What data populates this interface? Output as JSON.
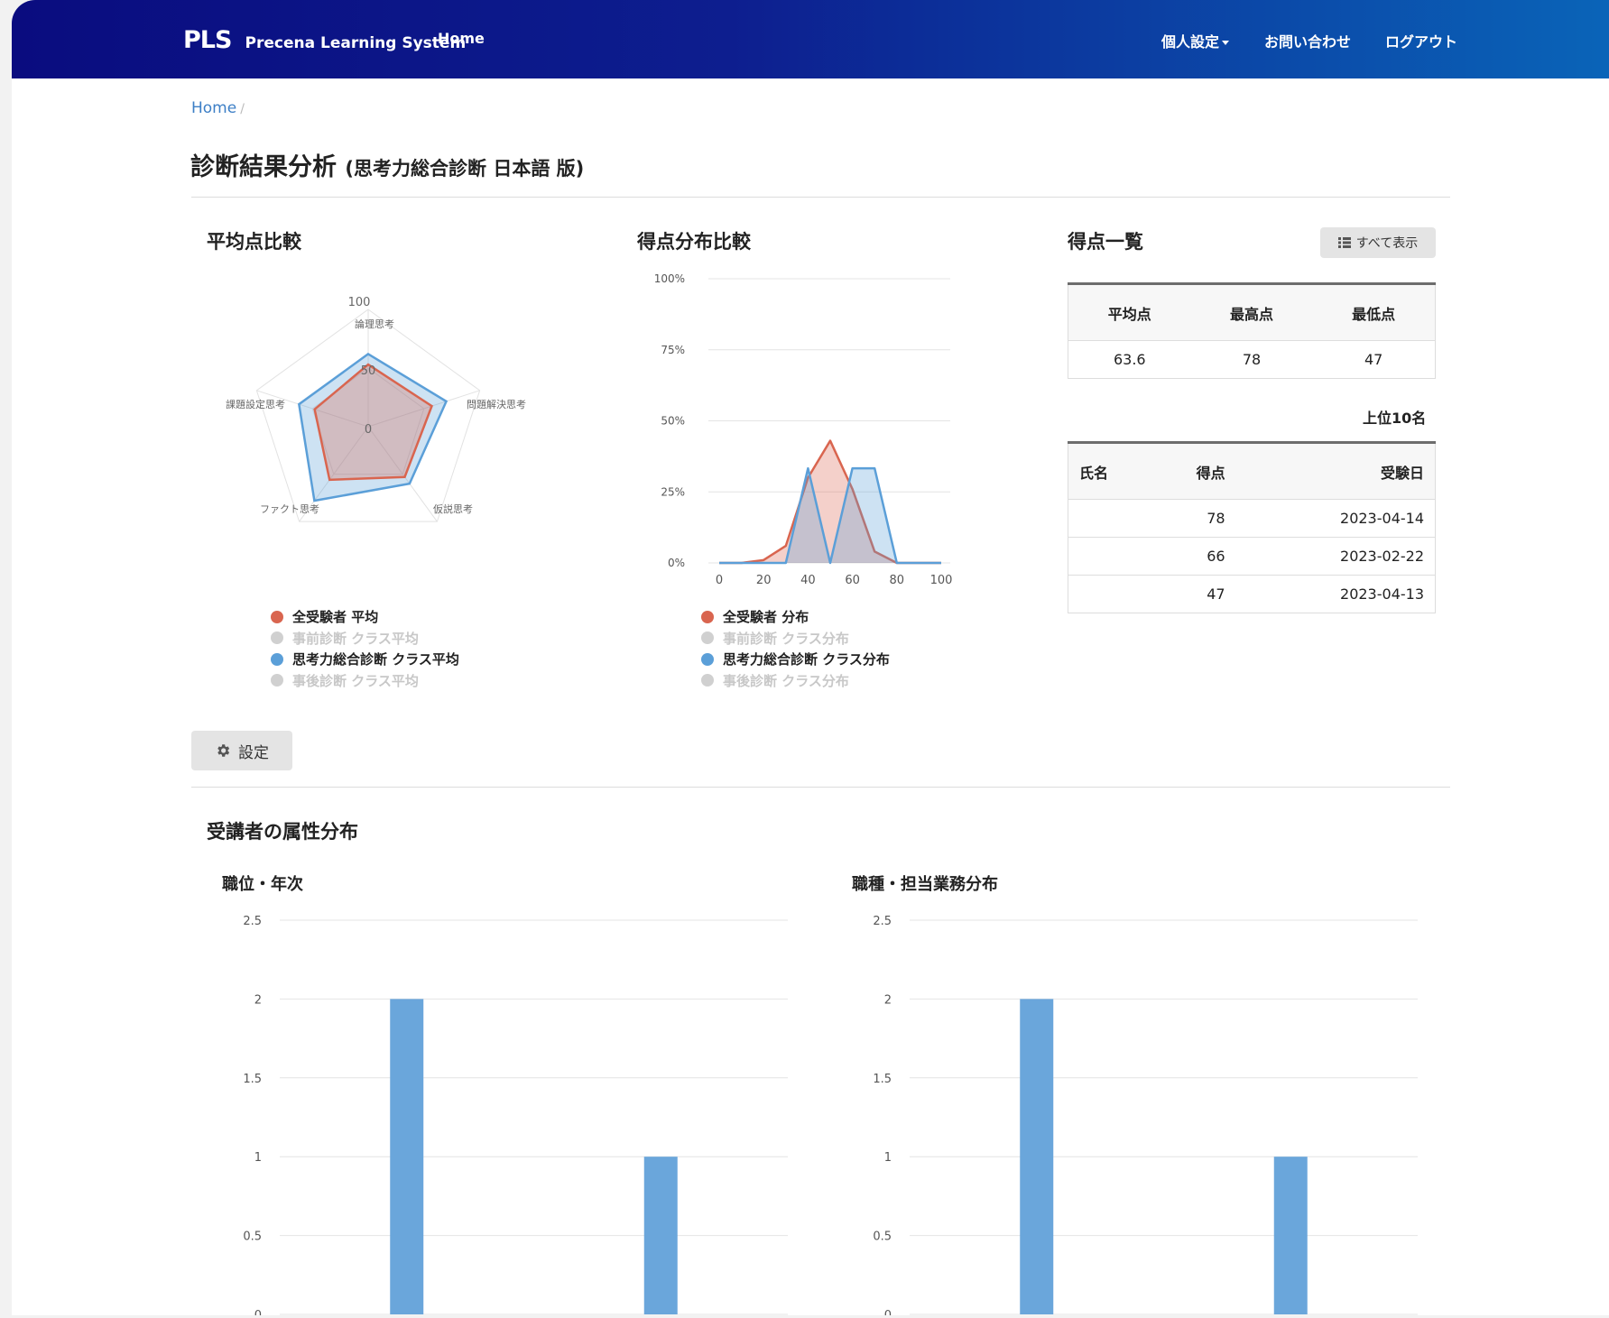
{
  "header": {
    "brand_short": "PLS",
    "brand_name": "Precena Learning System",
    "nav_home": "Home",
    "nav_personal": "個人設定",
    "nav_contact": "お問い合わせ",
    "nav_logout": "ログアウト"
  },
  "breadcrumb": {
    "home": "Home",
    "separator": "/"
  },
  "page": {
    "title": "診断結果分析",
    "subtitle": "(思考力総合診断 日本語 版)"
  },
  "avg_section": {
    "title": "平均点比較"
  },
  "dist_section": {
    "title": "得点分布比較"
  },
  "score_section": {
    "title": "得点一覧",
    "show_all_label": "すべて表示",
    "summary_headers": [
      "平均点",
      "最高点",
      "最低点"
    ],
    "summary_values": [
      "63.6",
      "78",
      "47"
    ],
    "top10_label": "上位10名",
    "rank_headers": [
      "氏名",
      "得点",
      "受験日"
    ],
    "rank_rows": [
      {
        "name": "",
        "score": "78",
        "date": "2023-04-14"
      },
      {
        "name": "",
        "score": "66",
        "date": "2023-02-22"
      },
      {
        "name": "",
        "score": "47",
        "date": "2023-04-13"
      }
    ]
  },
  "settings_label": "設定",
  "attr_section": {
    "title": "受講者の属性分布"
  },
  "colors": {
    "red": "#d9654f",
    "blue": "#5b9fd8",
    "legend_off": "#d0d0d0",
    "bar": "#6aa6db"
  },
  "icons": {
    "list": "list-icon",
    "gear": "gear-icon"
  },
  "chart_data": [
    {
      "type": "radar",
      "title": "平均点比較",
      "axes": [
        "論理思考",
        "問題解決思考",
        "仮説思考",
        "ファクト思考",
        "課題設定思考"
      ],
      "scale_ticks": [
        "0",
        "50",
        "100"
      ],
      "range": [
        0,
        100
      ],
      "series": [
        {
          "name": "全受験者 平均",
          "values": [
            53,
            57,
            53,
            56,
            48
          ],
          "color": "#d9654f",
          "visible": true
        },
        {
          "name": "事前診断 クラス平均",
          "values": [],
          "visible": false
        },
        {
          "name": "思考力総合診断 クラス平均",
          "values": [
            62,
            70,
            60,
            78,
            62
          ],
          "color": "#5b9fd8",
          "visible": true
        },
        {
          "name": "事後診断 クラス平均",
          "values": [],
          "visible": false
        }
      ]
    },
    {
      "type": "area",
      "title": "得点分布比較",
      "x": [
        0,
        10,
        20,
        30,
        40,
        50,
        60,
        70,
        80,
        90,
        100
      ],
      "x_ticks": [
        "0",
        "20",
        "40",
        "60",
        "80",
        "100"
      ],
      "y_ticks": [
        "0%",
        "25%",
        "50%",
        "75%",
        "100%"
      ],
      "ylim": [
        0,
        100
      ],
      "series": [
        {
          "name": "全受験者 分布",
          "values": [
            0,
            0,
            1,
            6,
            30,
            43,
            26,
            4,
            0,
            0,
            0
          ],
          "color": "#d9654f",
          "visible": true
        },
        {
          "name": "事前診断 クラス分布",
          "values": [],
          "visible": false
        },
        {
          "name": "思考力総合診断 クラス分布",
          "values": [
            0,
            0,
            0,
            0,
            33.3,
            0,
            33.3,
            33.3,
            0,
            0,
            0
          ],
          "color": "#5b9fd8",
          "visible": true
        },
        {
          "name": "事後診断 クラス分布",
          "values": [],
          "visible": false
        }
      ]
    },
    {
      "type": "bar",
      "title": "職位・年次",
      "categories": [
        "",
        ""
      ],
      "values": [
        2,
        1
      ],
      "y_ticks": [
        "0",
        "0.5",
        "1",
        "1.5",
        "2",
        "2.5"
      ],
      "ylim": [
        0,
        2.5
      ]
    },
    {
      "type": "bar",
      "title": "職種・担当業務分布",
      "categories": [
        "",
        ""
      ],
      "values": [
        2,
        1
      ],
      "y_ticks": [
        "0",
        "0.5",
        "1",
        "1.5",
        "2",
        "2.5"
      ],
      "ylim": [
        0,
        2.5
      ]
    }
  ]
}
